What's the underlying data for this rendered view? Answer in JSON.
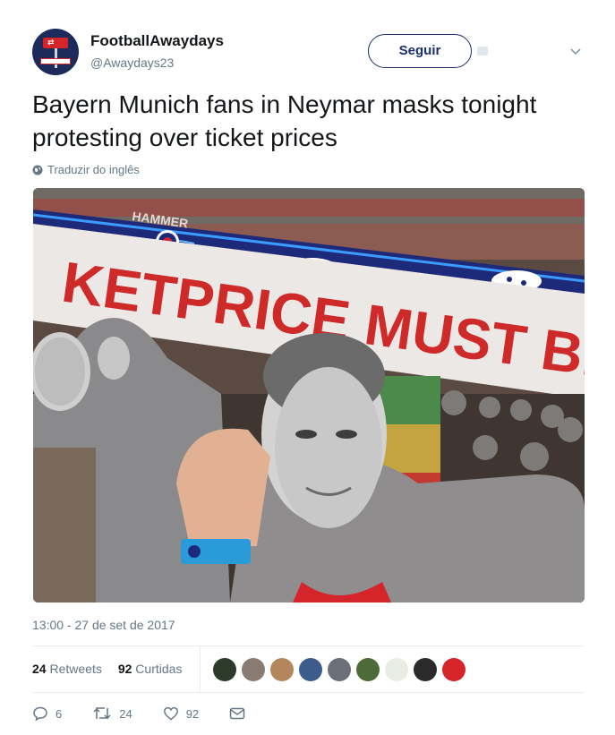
{
  "account": {
    "display_name": "FootballAwaydays",
    "handle": "@Awaydays23",
    "follow_label": "Seguir"
  },
  "tweet": {
    "text": "Bayern Munich fans in Neymar masks tonight protesting over ticket prices",
    "translate_label": "Traduzir do inglês",
    "timestamp": "13:00 - 27 de set de 2017"
  },
  "photo": {
    "banner_text": "KETPRICE MUST BE",
    "stand_sign": "HAMMER"
  },
  "stats": {
    "retweets_count": "24",
    "retweets_label": "Retweets",
    "likes_count": "92",
    "likes_label": "Curtidas"
  },
  "likers": [
    {
      "color": "#2e3b2b"
    },
    {
      "color": "#8a7b72"
    },
    {
      "color": "#b3865e"
    },
    {
      "color": "#3d5c8c"
    },
    {
      "color": "#6b6f78"
    },
    {
      "color": "#4f6a3a"
    },
    {
      "color": "#e9ece4"
    },
    {
      "color": "#2a2a2a"
    },
    {
      "color": "#d6242b"
    }
  ],
  "actions": {
    "reply_count": "6",
    "retweet_count": "24",
    "like_count": "92"
  },
  "icons": {
    "reply": "reply-icon",
    "retweet": "retweet-icon",
    "like": "heart-icon",
    "dm": "envelope-icon",
    "globe": "globe-icon",
    "chevron": "chevron-down-icon"
  }
}
